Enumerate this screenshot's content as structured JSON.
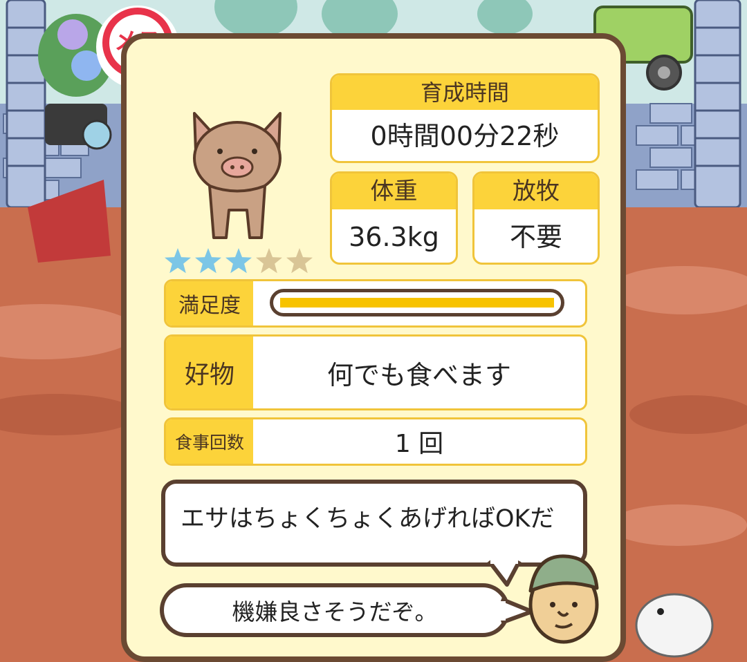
{
  "gender": {
    "label": "メス"
  },
  "pig": {
    "stars_filled": 3,
    "stars_total": 5
  },
  "stats": {
    "raise_time": {
      "label": "育成時間",
      "value": "0時間00分22秒"
    },
    "weight": {
      "label": "体重",
      "value": "36.3kg"
    },
    "grazing": {
      "label": "放牧",
      "value": "不要"
    }
  },
  "details": {
    "satisfaction": {
      "label": "満足度",
      "level": 1.0
    },
    "favorite": {
      "label": "好物",
      "value": "何でも食べます"
    },
    "meals": {
      "label": "食事回数",
      "value": "1 回"
    }
  },
  "dialogue": {
    "hint": "エサはちょくちょくあげればOKだ",
    "mood": "機嫌良さそうだぞ。"
  },
  "colors": {
    "card_bg": "#fff9cc",
    "card_border": "#6b4a33",
    "label_yellow": "#fcd33a",
    "bar_fill": "#f7c300",
    "star_filled": "#7cc6e6",
    "star_empty": "#d9c596",
    "gender_red": "#e8334a"
  }
}
